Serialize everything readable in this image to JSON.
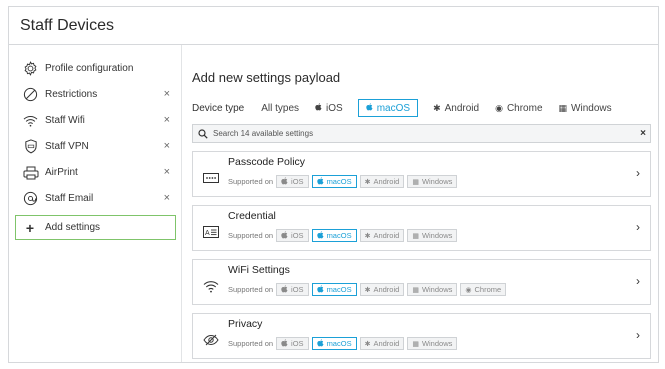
{
  "window": {
    "title": "Staff Devices"
  },
  "sidebar": {
    "items": [
      {
        "label": "Profile configuration",
        "icon": "gear-icon",
        "removable": false
      },
      {
        "label": "Restrictions",
        "icon": "restriction-icon",
        "removable": true,
        "remove_glyph": "×"
      },
      {
        "label": "Staff Wifi",
        "icon": "wifi-icon",
        "removable": true,
        "remove_glyph": "×"
      },
      {
        "label": "Staff VPN",
        "icon": "vpn-shield-icon",
        "removable": true,
        "remove_glyph": "×"
      },
      {
        "label": "AirPrint",
        "icon": "printer-icon",
        "removable": true,
        "remove_glyph": "×"
      },
      {
        "label": "Staff Email",
        "icon": "email-icon",
        "removable": true,
        "remove_glyph": "×"
      },
      {
        "label": "Add settings",
        "icon": "plus-icon",
        "glyph": "+"
      }
    ]
  },
  "main": {
    "title": "Add new settings payload",
    "device_type": {
      "label": "Device type",
      "options": [
        "All types",
        "iOS",
        "macOS",
        "Android",
        "Chrome",
        "Windows"
      ],
      "selected": "macOS"
    },
    "search": {
      "placeholder": "Search 14 available settings",
      "clear_glyph": "×"
    },
    "supported_label": "Supported on",
    "chevron": "›",
    "cards": [
      {
        "name": "Passcode Policy",
        "icon": "keypad-icon",
        "platforms": [
          "iOS",
          "macOS",
          "Android",
          "Windows"
        ]
      },
      {
        "name": "Credential",
        "icon": "id-card-icon",
        "platforms": [
          "iOS",
          "macOS",
          "Android",
          "Windows"
        ]
      },
      {
        "name": "WiFi Settings",
        "icon": "wifi-icon",
        "platforms": [
          "iOS",
          "macOS",
          "Android",
          "Windows",
          "Chrome"
        ]
      },
      {
        "name": "Privacy",
        "icon": "eye-slash-icon",
        "platforms": [
          "iOS",
          "macOS",
          "Android",
          "Windows"
        ]
      }
    ]
  },
  "colors": {
    "accent": "#1ba0d7",
    "add_border": "#7fc46a",
    "border": "#d6d8db"
  }
}
